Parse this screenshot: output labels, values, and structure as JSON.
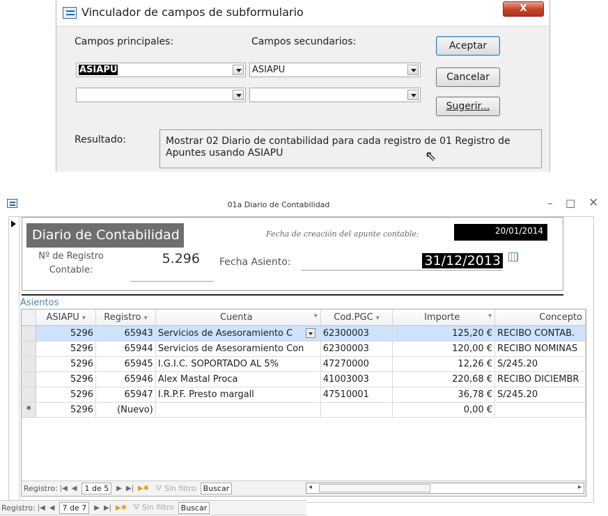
{
  "dialog": {
    "title": "Vinculador de campos de subformulario",
    "close_label": "X",
    "main_fields_label": "Campos principales:",
    "secondary_fields_label": "Campos secundarios:",
    "main_field_1": "ASIAPU",
    "secondary_field_1": "ASIAPU",
    "accept_label": "Aceptar",
    "cancel_label": "Cancelar",
    "suggest_label": "Sugerir...",
    "result_label": "Resultado:",
    "result_text": "Mostrar 02 Diario de contabilidad para cada registro de 01 Registro de Apuntes usando ASIAPU"
  },
  "form": {
    "title": "01a Diario de Contabilidad",
    "minimize": "–",
    "maximize": "□",
    "close": "×",
    "header_title": "Diario de Contabilidad",
    "creation_date_label": "Fecha de creación del apunte contable:",
    "creation_date_value": "20/01/2014",
    "record_number_label": "Nº de Registro Contable:",
    "record_number_value": "5.296",
    "entry_date_label": "Fecha Asiento:",
    "entry_date_value": "31/12/2013"
  },
  "subform": {
    "label": "Asientos",
    "columns": [
      "ASIAPU",
      "Registro",
      "Cuenta",
      "Cod.PGC",
      "Importe",
      "Concepto"
    ],
    "rows": [
      {
        "asiapu": "5296",
        "registro": "65943",
        "cuenta": "Servicios de Asesoramiento C",
        "pgc": "62300003",
        "importe": "125,20 €",
        "concepto": "RECIBO CONTAB."
      },
      {
        "asiapu": "5296",
        "registro": "65944",
        "cuenta": "Servicios de Asesoramiento Con",
        "pgc": "62300003",
        "importe": "120,00 €",
        "concepto": "RECIBO NOMINAS"
      },
      {
        "asiapu": "5296",
        "registro": "65945",
        "cuenta": "I.G.I.C. SOPORTADO AL 5%",
        "pgc": "47270000",
        "importe": "12,26 €",
        "concepto": "S/245.20"
      },
      {
        "asiapu": "5296",
        "registro": "65946",
        "cuenta": "Alex Mastal Proca",
        "pgc": "41003003",
        "importe": "220,68 €",
        "concepto": "RECIBO DICIEMBR"
      },
      {
        "asiapu": "5296",
        "registro": "65947",
        "cuenta": "I.R.P.F. Presto margall",
        "pgc": "47510001",
        "importe": "36,78 €",
        "concepto": "S/245.20"
      }
    ],
    "new_row": {
      "marker": "*",
      "asiapu": "5296",
      "registro": "(Nuevo)",
      "importe": "0,00 €"
    },
    "nav": {
      "label": "Registro:",
      "position": "1 de 5",
      "filter": "Sin filtro",
      "search": "Buscar"
    }
  },
  "main_nav": {
    "label": "Registro:",
    "position": "7 de 7",
    "filter": "Sin filtro",
    "search": "Buscar"
  }
}
